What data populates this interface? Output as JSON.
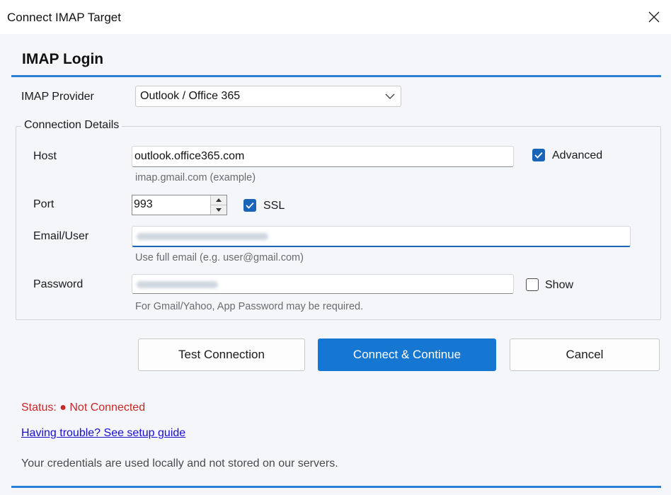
{
  "window": {
    "title": "Connect IMAP Target"
  },
  "heading": "IMAP Login",
  "provider": {
    "label": "IMAP Provider",
    "selected": "Outlook / Office 365"
  },
  "connection_details": {
    "title": "Connection Details",
    "host": {
      "label": "Host",
      "value": "outlook.office365.com",
      "hint": "imap.gmail.com (example)"
    },
    "advanced": {
      "label": "Advanced",
      "checked": true
    },
    "port": {
      "label": "Port",
      "value": "993"
    },
    "ssl": {
      "label": "SSL",
      "checked": true
    },
    "email": {
      "label": "Email/User",
      "hint": "Use full email (e.g. user@gmail.com)"
    },
    "password": {
      "label": "Password",
      "hint": "For Gmail/Yahoo, App Password may be required."
    },
    "show": {
      "label": "Show",
      "checked": false
    }
  },
  "buttons": {
    "test": "Test Connection",
    "connect": "Connect & Continue",
    "cancel": "Cancel"
  },
  "status": "Status: ● Not Connected",
  "help_link": "Having trouble? See setup guide",
  "note": "Your credentials are used locally and not stored on our servers.",
  "colors": {
    "accent": "#1677d2",
    "status": "#c62828",
    "link": "#1a0dcc"
  },
  "icons": {
    "close": "close-icon",
    "dropdown": "chevron-down-icon",
    "check": "checkmark-icon"
  }
}
